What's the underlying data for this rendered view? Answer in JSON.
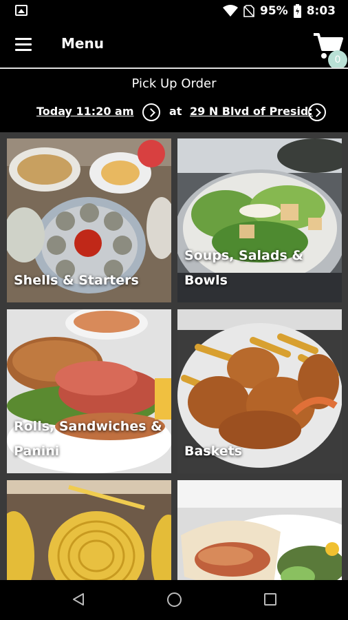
{
  "status_bar": {
    "battery": "95%",
    "time": "8:03"
  },
  "app_bar": {
    "title": "Menu",
    "cart_count": "0"
  },
  "pickup": {
    "title": "Pick Up Order",
    "time": "Today 11:20 am",
    "at_label": "at",
    "location": "29 N Blvd of Presid:"
  },
  "categories": [
    {
      "label": "Shells & Starters"
    },
    {
      "label": "Soups, Salads & Bowls"
    },
    {
      "label": "Rolls, Sandwiches & Panini"
    },
    {
      "label": "Baskets"
    },
    {
      "label": ""
    },
    {
      "label": ""
    }
  ],
  "colors": {
    "accent_badge": "#b9e0d5",
    "background": "#000000",
    "grid_bg": "#3a3a3a"
  }
}
